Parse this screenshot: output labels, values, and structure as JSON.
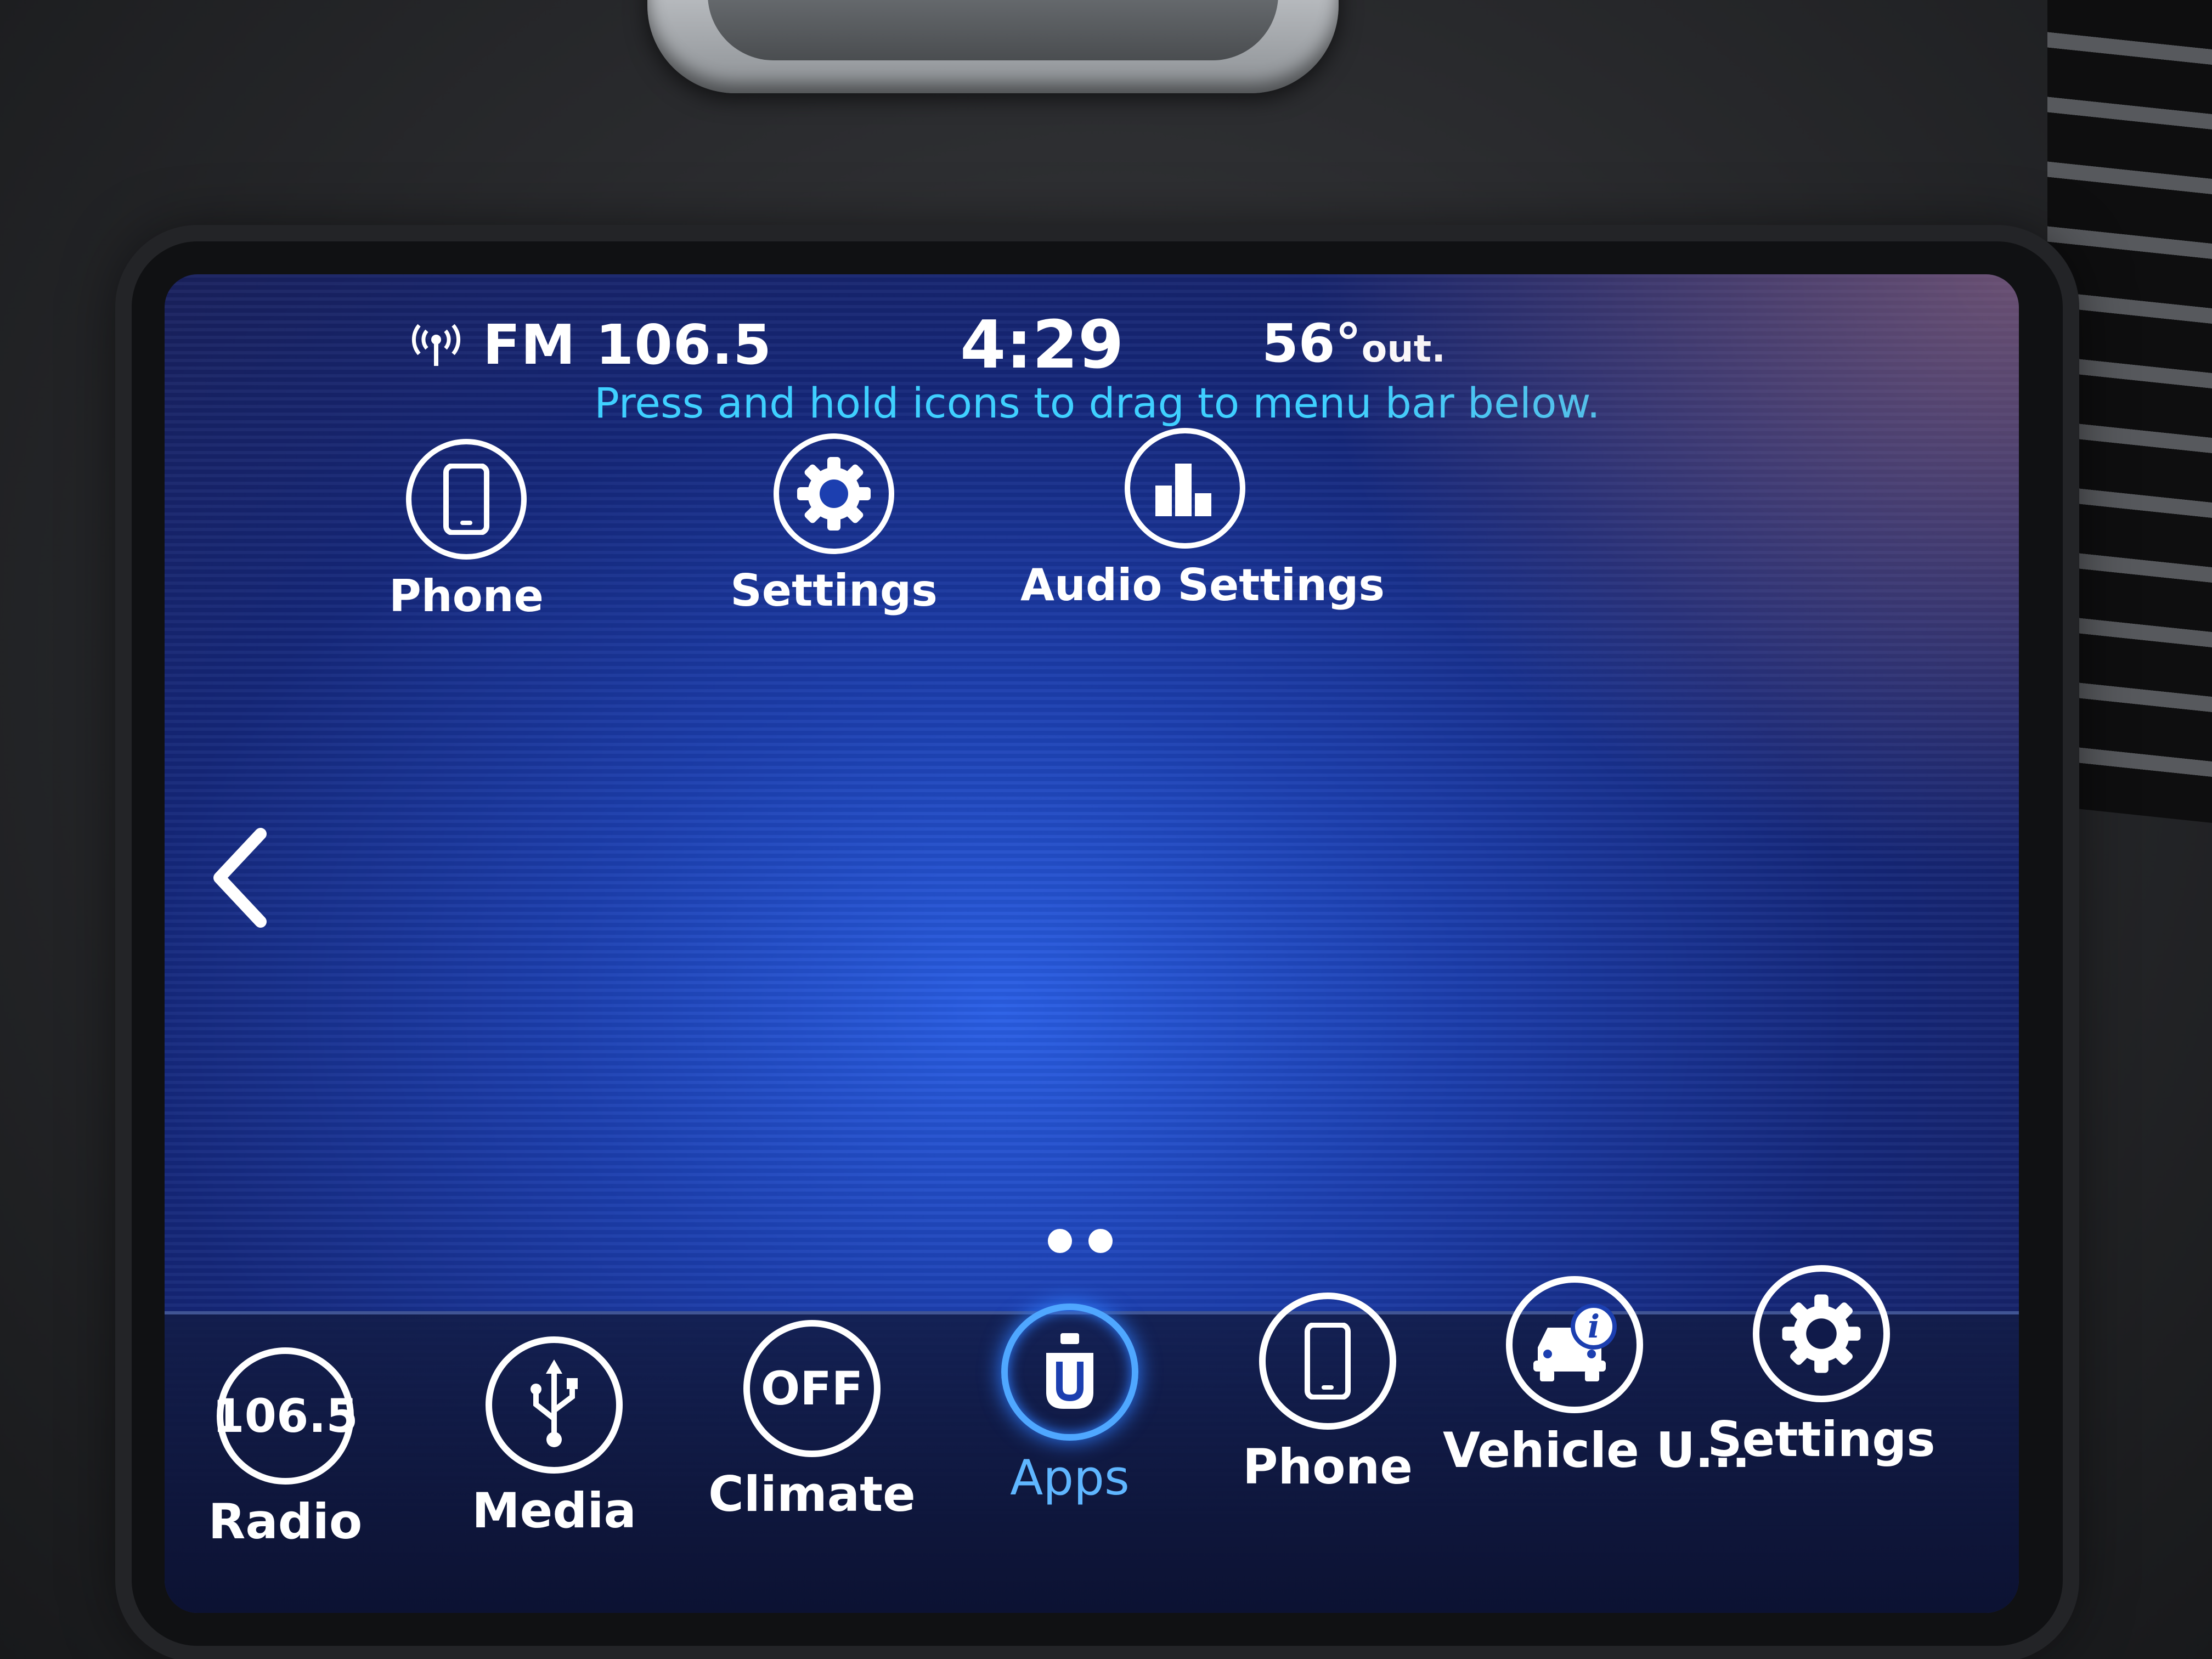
{
  "status": {
    "radio": "FM 106.5",
    "clock": "4:29",
    "temperature": "56°",
    "temperature_suffix": "out."
  },
  "hint": "Press and hold icons to drag to menu bar below.",
  "apps": [
    {
      "label": "Phone",
      "icon": "phone-icon"
    },
    {
      "label": "Settings",
      "icon": "gear-icon"
    },
    {
      "label": "Audio Settings",
      "icon": "audio-settings-icon"
    }
  ],
  "pager": {
    "pages": 2
  },
  "menubar": [
    {
      "label": "Radio",
      "icon": "radio-icon",
      "icon_text": "106.5"
    },
    {
      "label": "Media",
      "icon": "usb-icon"
    },
    {
      "label": "Climate",
      "icon": "climate-icon",
      "icon_text": "OFF"
    },
    {
      "label": "Apps",
      "icon": "apps-icon",
      "active": true
    },
    {
      "label": "Phone",
      "icon": "phone-icon"
    },
    {
      "label": "Vehicle U...",
      "icon": "vehicle-info-icon"
    },
    {
      "label": "Settings",
      "icon": "gear-icon"
    }
  ],
  "colors": {
    "hint_text": "#3fd0ff",
    "active_accent": "#4fa7ff",
    "screen_blue": "#1c3fb0"
  }
}
